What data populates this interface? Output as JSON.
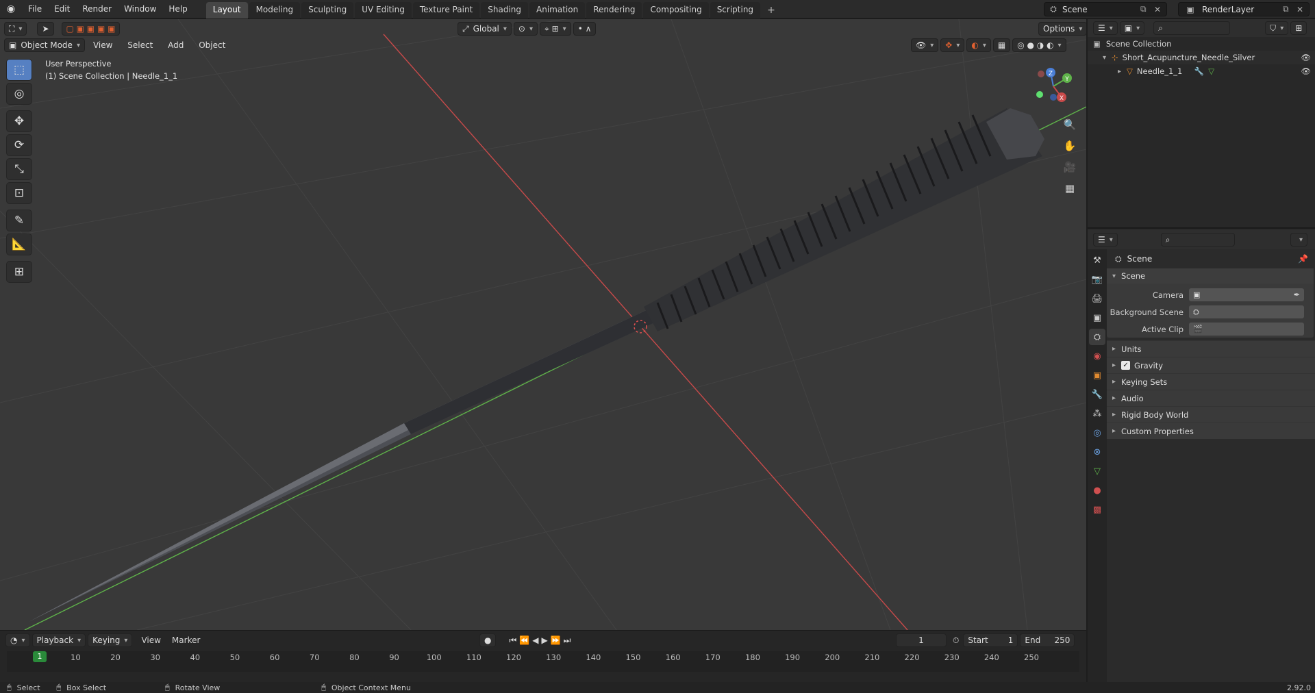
{
  "menubar": {
    "items": [
      "File",
      "Edit",
      "Render",
      "Window",
      "Help"
    ]
  },
  "workspaces": [
    {
      "label": "Layout",
      "active": true
    },
    {
      "label": "Modeling",
      "active": false
    },
    {
      "label": "Sculpting",
      "active": false
    },
    {
      "label": "UV Editing",
      "active": false
    },
    {
      "label": "Texture Paint",
      "active": false
    },
    {
      "label": "Shading",
      "active": false
    },
    {
      "label": "Animation",
      "active": false
    },
    {
      "label": "Rendering",
      "active": false
    },
    {
      "label": "Compositing",
      "active": false
    },
    {
      "label": "Scripting",
      "active": false
    }
  ],
  "scene": {
    "name": "Scene",
    "render_layer": "RenderLayer"
  },
  "viewport": {
    "mode": "Object Mode",
    "menus": [
      "View",
      "Select",
      "Add",
      "Object"
    ],
    "orientation": "Global",
    "options_label": "Options",
    "perspective_label": "User Perspective",
    "collection_label": "(1) Scene Collection | Needle_1_1",
    "gizmo": {
      "z": "Z",
      "y": "Y",
      "x": "X"
    }
  },
  "outliner": {
    "root": "Scene Collection",
    "items": [
      {
        "label": "Short_Acupuncture_Needle_Silver",
        "icon": "empty-icon"
      },
      {
        "label": "Needle_1_1",
        "icon": "mesh-icon"
      }
    ]
  },
  "properties": {
    "context": "Scene",
    "panel_title": "Scene",
    "fields": [
      {
        "label": "Camera",
        "value": ""
      },
      {
        "label": "Background Scene",
        "value": ""
      },
      {
        "label": "Active Clip",
        "value": ""
      }
    ],
    "subsections": [
      "Units",
      "Gravity",
      "Keying Sets",
      "Audio",
      "Rigid Body World",
      "Custom Properties"
    ],
    "gravity_checked": true
  },
  "timeline": {
    "menus": [
      "Playback",
      "Keying",
      "View",
      "Marker"
    ],
    "current_frame": "1",
    "start_label": "Start",
    "start": "1",
    "end_label": "End",
    "end": "250",
    "ticks": [
      "10",
      "20",
      "30",
      "40",
      "50",
      "60",
      "70",
      "80",
      "90",
      "100",
      "110",
      "120",
      "130",
      "140",
      "150",
      "160",
      "170",
      "180",
      "190",
      "200",
      "210",
      "220",
      "230",
      "240",
      "250"
    ]
  },
  "status": {
    "select": "Select",
    "box_select": "Box Select",
    "rotate_view": "Rotate View",
    "context_menu": "Object Context Menu",
    "version": "2.92.0"
  },
  "colors": {
    "x_axis": "#c84a4a",
    "y_axis": "#5fb34a",
    "z_axis": "#4a7ed6",
    "accent": "#5680c2",
    "playhead": "#2a8a3a"
  }
}
